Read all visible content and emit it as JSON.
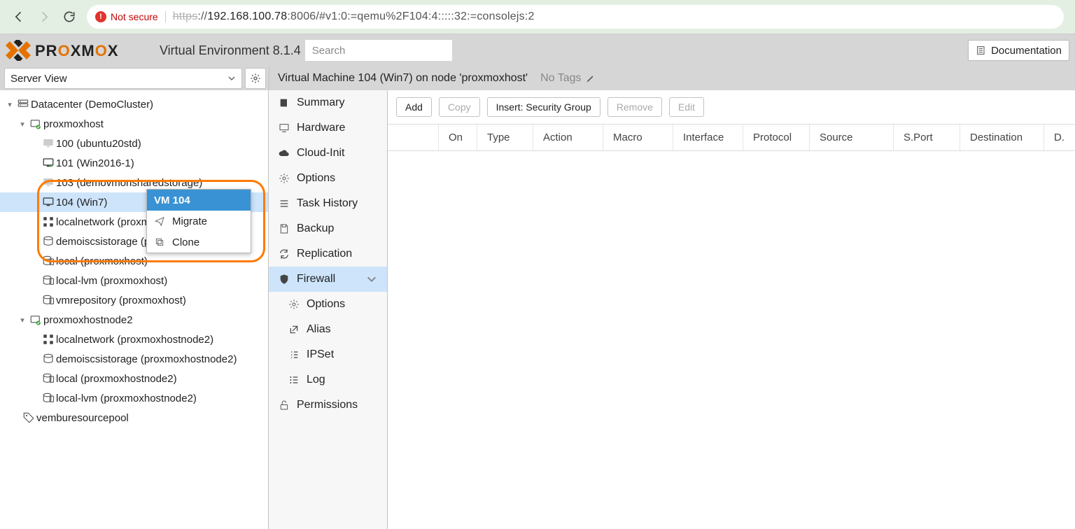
{
  "browser": {
    "not_secure": "Not secure",
    "url_https": "https",
    "url_rest1": "://",
    "url_host": "192.168.100.78",
    "url_port": ":8006",
    "url_path": "/#v1:0:=qemu%2F104:4:::::32:=consolejs:2"
  },
  "header": {
    "env_label": "Virtual Environment 8.1.4",
    "search_ph": "Search",
    "doc_btn": "Documentation"
  },
  "toolbar": {
    "view": "Server View",
    "title": "Virtual Machine 104 (Win7) on node 'proxmoxhost'",
    "notags": "No Tags"
  },
  "tree": {
    "dc": "Datacenter (DemoCluster)",
    "node1": "proxmoxhost",
    "vm100": "100 (ubuntu20std)",
    "vm101": "101 (Win2016-1)",
    "vm103": "103 (demovmonsharedstorage)",
    "vm104": "104 (Win7)",
    "net1": "localnetwork (proxmoxhost)",
    "stor1": "demoiscsistorage (proxmoxhost)",
    "stor2": "local (proxmoxhost)",
    "stor3": "local-lvm (proxmoxhost)",
    "stor4": "vmrepository (proxmoxhost)",
    "node2": "proxmoxhostnode2",
    "net2": "localnetwork (proxmoxhostnode2)",
    "stor5": "demoiscsistorage (proxmoxhostnode2)",
    "stor6": "local (proxmoxhostnode2)",
    "stor7": "local-lvm (proxmoxhostnode2)",
    "pool": "vemburesourcepool"
  },
  "ctx": {
    "title": "VM 104",
    "migrate": "Migrate",
    "clone": "Clone"
  },
  "subnav": {
    "summary": "Summary",
    "hardware": "Hardware",
    "cloudinit": "Cloud-Init",
    "options": "Options",
    "task": "Task History",
    "backup": "Backup",
    "repl": "Replication",
    "firewall": "Firewall",
    "fw_options": "Options",
    "alias": "Alias",
    "ipset": "IPSet",
    "log": "Log",
    "perm": "Permissions"
  },
  "buttons": {
    "add": "Add",
    "copy": "Copy",
    "insert": "Insert: Security Group",
    "remove": "Remove",
    "edit": "Edit"
  },
  "grid": {
    "on": "On",
    "type": "Type",
    "action": "Action",
    "macro": "Macro",
    "iface": "Interface",
    "proto": "Protocol",
    "source": "Source",
    "sport": "S.Port",
    "dest": "Destination",
    "dport": "D."
  }
}
